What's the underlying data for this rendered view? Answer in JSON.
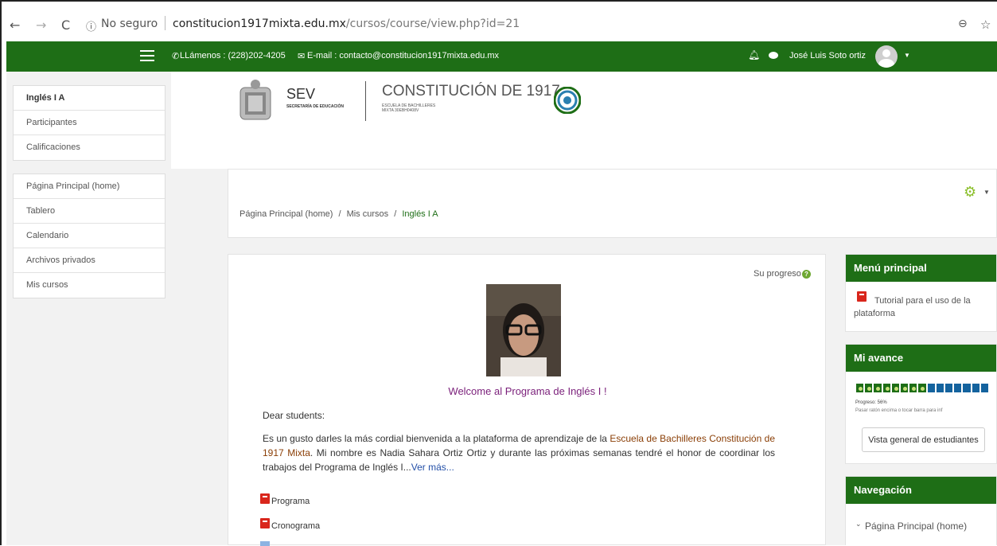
{
  "browser": {
    "not_secure": "No seguro",
    "url_host": "constitucion1917mixta.edu.mx",
    "url_path": "/cursos/course/view.php?id=21"
  },
  "topbar": {
    "phone": "LLámenos : (228)202-4205",
    "email": "E-mail : contacto@constitucion1917mixta.edu.mx",
    "user_name": "José Luis Soto ortiz"
  },
  "sidebar": {
    "course_items": [
      "Inglés I A",
      "Participantes",
      "Calificaciones"
    ],
    "site_items": [
      "Página Principal (home)",
      "Tablero",
      "Calendario",
      "Archivos privados",
      "Mis cursos"
    ]
  },
  "logo": {
    "sev": "SEV",
    "sev_sub": "SECRETARÍA DE EDUCACIÓN",
    "school": "CONSTITUCIÓN DE 1917",
    "school_sub1": "ESCUELA DE BACHILLERES",
    "school_sub2": "MIXTA 30EBH0408V"
  },
  "breadcrumb": [
    "Página Principal (home)",
    "Mis cursos",
    "Inglés I A"
  ],
  "breadcrumb_sep": "/",
  "main": {
    "progress_label": "Su progreso",
    "welcome": "Welcome al Programa de Inglés I !",
    "greeting": "Dear students:",
    "para_a": "Es un gusto darles la más cordial bienvenida a la plataforma de aprendizaje de la ",
    "para_link": "Escuela de Bachilleres Constitución de 1917 Mixta",
    "para_b": ". Mi nombre es Nadia Sahara Ortiz Ortiz y durante las próximas semanas tendré el honor de coordinar los trabajos del Programa de Inglés I...",
    "see_more": "Ver más...",
    "resources": [
      "Programa",
      "Cronograma"
    ]
  },
  "right": {
    "menu_title": "Menú principal",
    "menu_item": "Tutorial para el uso de la plataforma",
    "progress_title": "Mi avance",
    "progress_text": "Progreso: 56%",
    "progress_value": 0.56,
    "progress_hint": "Pasar ratón encima o tocar barra para inf",
    "overview_button": "Vista general de estudiantes",
    "nav_title": "Navegación",
    "nav_item": "Página Principal (home)"
  },
  "colors": {
    "brand_green": "#1e6e16",
    "progress_todo": "#14639e",
    "pdf_red": "#d9261c",
    "welcome_purple": "#7a1f7a"
  }
}
